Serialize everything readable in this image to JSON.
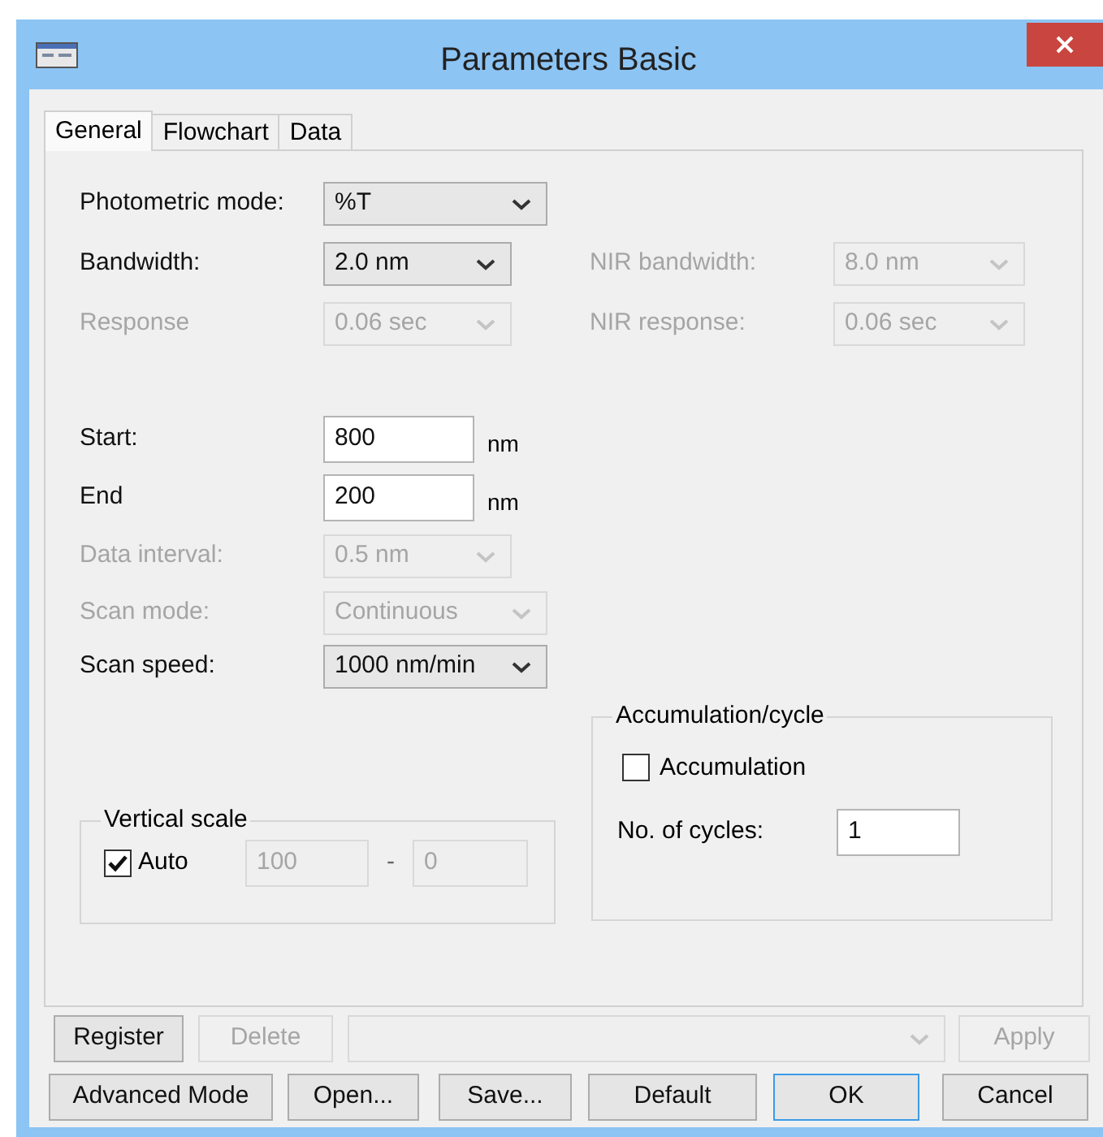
{
  "window": {
    "title": "Parameters  Basic"
  },
  "tabs": [
    {
      "label": "General",
      "selected": true
    },
    {
      "label": "Flowchart",
      "selected": false
    },
    {
      "label": "Data",
      "selected": false
    }
  ],
  "mode_fields": [
    {
      "label": "Photometric mode:",
      "value": "%T",
      "disabled": false
    },
    {
      "label": "Bandwidth:",
      "value": "2.0 nm",
      "disabled": false
    },
    {
      "label": "Response",
      "value": "0.06 sec",
      "disabled": true
    }
  ],
  "nir_fields": [
    {
      "label": "NIR bandwidth:",
      "value": "8.0 nm",
      "disabled": true
    },
    {
      "label": "NIR response:",
      "value": "0.06 sec",
      "disabled": true
    }
  ],
  "range_fields": [
    {
      "label": "Start:",
      "value": "800",
      "unit": "nm"
    },
    {
      "label": "End",
      "value": "200",
      "unit": "nm"
    }
  ],
  "scan_fields": [
    {
      "label": "Data interval:",
      "value": "0.5 nm",
      "disabled": true
    },
    {
      "label": "Scan mode:",
      "value": "Continuous",
      "disabled": true
    },
    {
      "label": "Scan speed:",
      "value": "1000 nm/min",
      "disabled": false
    }
  ],
  "vertical_scale": {
    "title": "Vertical scale",
    "auto_label": "Auto",
    "auto_checked": true,
    "from": "100",
    "separator": "-",
    "to": "0"
  },
  "accumulation": {
    "title": "Accumulation/cycle",
    "checkbox_label": "Accumulation",
    "checked": false,
    "cycles_label": "No. of cycles:",
    "cycles": "1"
  },
  "register_row": [
    {
      "label": "Register",
      "disabled": false
    },
    {
      "label": "Delete",
      "disabled": true
    }
  ],
  "apply_button": {
    "label": "Apply",
    "disabled": true
  },
  "buttons": [
    {
      "label": "Advanced Mode",
      "default": false
    },
    {
      "label": "Open...",
      "default": false
    },
    {
      "label": "Save...",
      "default": false
    },
    {
      "label": "Default",
      "default": false
    },
    {
      "label": "OK",
      "default": true
    },
    {
      "label": "Cancel",
      "default": false
    }
  ]
}
